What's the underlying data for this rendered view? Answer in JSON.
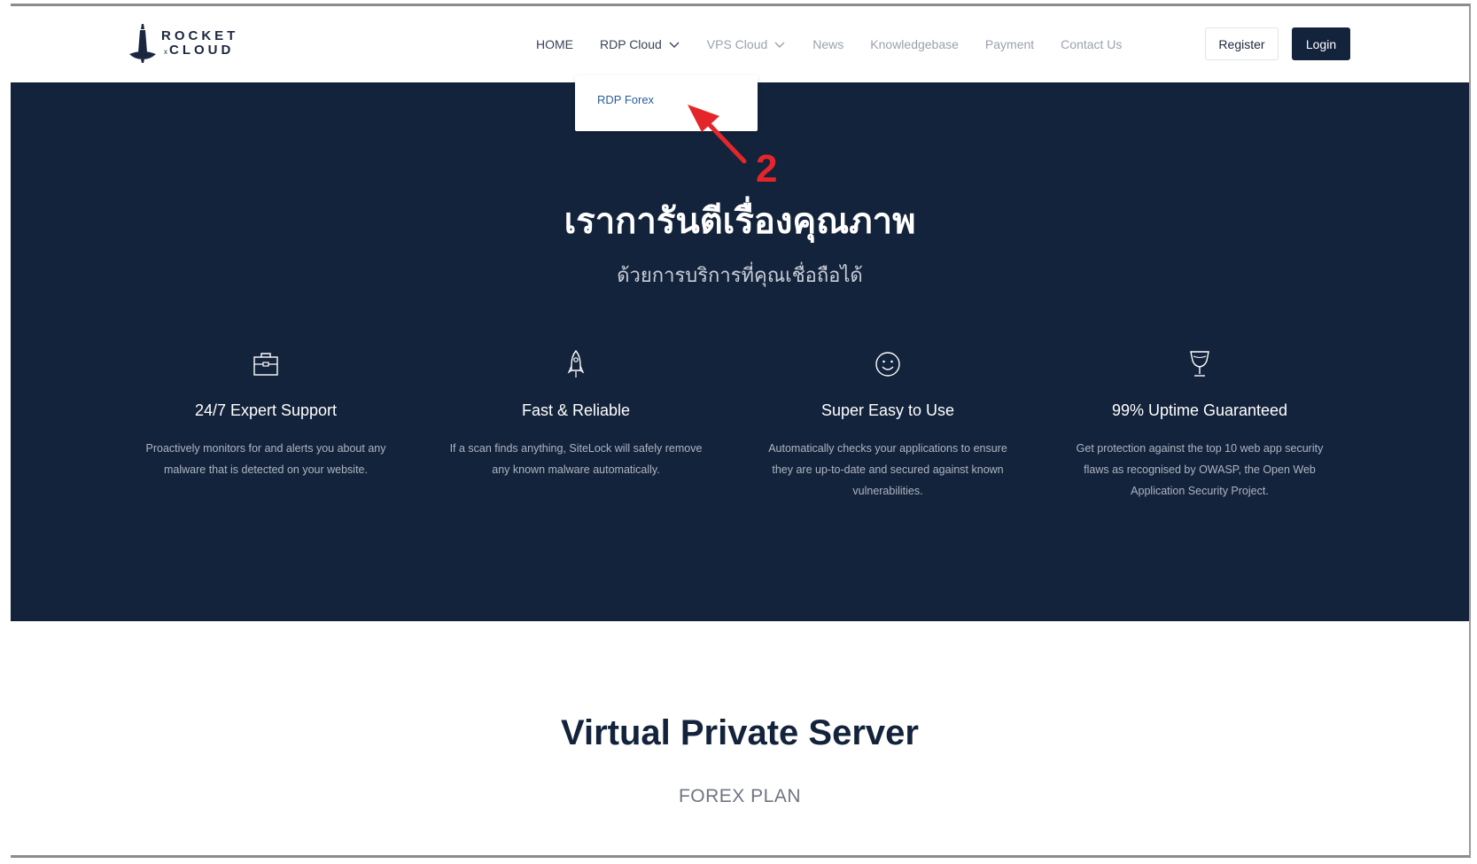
{
  "logo": {
    "line1": "ROCKET",
    "line2": "CLOUD",
    "mark": "x"
  },
  "nav": {
    "items": [
      {
        "label": "HOME"
      },
      {
        "label": "RDP Cloud"
      },
      {
        "label": "VPS Cloud"
      },
      {
        "label": "News"
      },
      {
        "label": "Knowledgebase"
      },
      {
        "label": "Payment"
      },
      {
        "label": "Contact Us"
      }
    ],
    "register_label": "Register",
    "login_label": "Login"
  },
  "dropdown": {
    "item": "RDP Forex"
  },
  "annotation": {
    "number": "2",
    "color": "#e4262a"
  },
  "hero": {
    "title": "เราการันตีเรื่องคุณภาพ",
    "subtitle": "ด้วยการบริการที่คุณเชื่อถือได้",
    "features": [
      {
        "icon": "briefcase-icon",
        "title": "24/7 Expert Support",
        "desc_line1": "Proactively monitors for and alerts you about any",
        "desc_line2": "malware that is detected on your website.",
        "desc_line3": ""
      },
      {
        "icon": "rocket-icon",
        "title": "Fast & Reliable",
        "desc_line1": "If a scan finds anything, SiteLock will safely remove",
        "desc_line2": "any known malware automatically.",
        "desc_line3": ""
      },
      {
        "icon": "smiley-icon",
        "title": "Super Easy to Use",
        "desc_line1": "Automatically checks your applications to ensure",
        "desc_line2": "they are up-to-date and secured against known",
        "desc_line3": "vulnerabilities."
      },
      {
        "icon": "trophy-icon",
        "title": "99% Uptime Guaranteed",
        "desc_line1": "Get protection against the top 10 web app security",
        "desc_line2": "flaws as recognised by OWASP, the Open Web",
        "desc_line3": "Application Security Project."
      }
    ]
  },
  "section": {
    "title": "Virtual Private Server",
    "subtitle": "FOREX PLAN"
  },
  "colors": {
    "navy": "#13233b",
    "accent_link": "#2b5d9a",
    "annotation_red": "#e4262a"
  }
}
